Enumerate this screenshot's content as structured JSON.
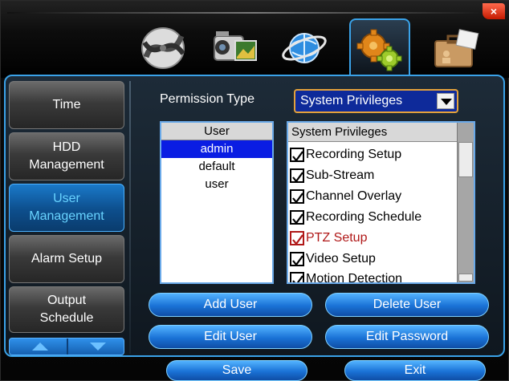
{
  "window": {
    "close_label": "×"
  },
  "tabs": [
    {
      "icon": "film-reel-icon",
      "active": false
    },
    {
      "icon": "camcorder-icon",
      "active": false
    },
    {
      "icon": "globe-network-icon",
      "active": false
    },
    {
      "icon": "gears-settings-icon",
      "active": true
    },
    {
      "icon": "briefcase-info-icon",
      "active": false
    }
  ],
  "sidebar": {
    "items": [
      {
        "label": "Time"
      },
      {
        "label": "HDD\nManagement"
      },
      {
        "label": "User\nManagement"
      },
      {
        "label": "Alarm Setup"
      },
      {
        "label": "Output\nSchedule"
      }
    ]
  },
  "permission": {
    "label": "Permission Type",
    "selected": "System Privileges"
  },
  "users": {
    "header": "User",
    "rows": [
      "admin",
      "default",
      "user"
    ]
  },
  "privileges": {
    "header": "System Privileges",
    "rows": [
      {
        "label": "Recording Setup",
        "checked": true
      },
      {
        "label": "Sub-Stream",
        "checked": true
      },
      {
        "label": "Channel Overlay",
        "checked": true
      },
      {
        "label": "Recording Schedule",
        "checked": true
      },
      {
        "label": "PTZ Setup",
        "checked": true
      },
      {
        "label": "Video Setup",
        "checked": true
      },
      {
        "label": "Motion Detection",
        "checked": true
      }
    ]
  },
  "buttons": {
    "add_user": "Add User",
    "delete_user": "Delete User",
    "edit_user": "Edit User",
    "edit_password": "Edit Password",
    "save": "Save",
    "exit": "Exit"
  },
  "colors": {
    "accent": "#3aa2e8",
    "selected_row": "#0a1de3",
    "dropdown_bg": "#0e2a9a",
    "dropdown_border": "#e3a13b",
    "warning_text": "#b01818"
  }
}
